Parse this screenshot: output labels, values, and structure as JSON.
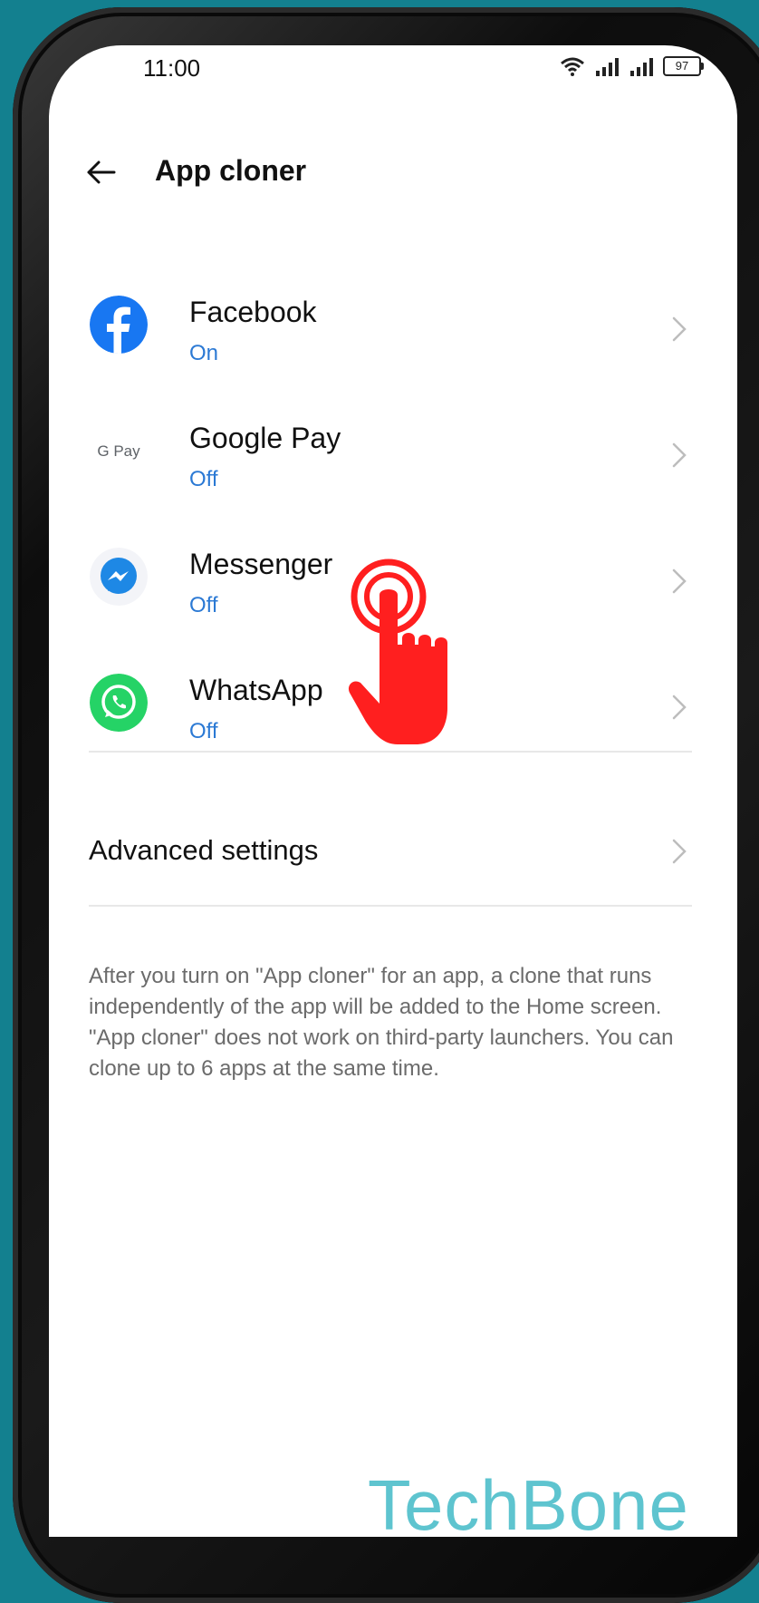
{
  "status_bar": {
    "time": "11:00",
    "battery": "97"
  },
  "header": {
    "title": "App cloner"
  },
  "apps": [
    {
      "name": "Facebook",
      "status": "On",
      "icon": "facebook-icon"
    },
    {
      "name": "Google Pay",
      "status": "Off",
      "icon": "google-pay-icon"
    },
    {
      "name": "Messenger",
      "status": "Off",
      "icon": "messenger-icon"
    },
    {
      "name": "WhatsApp",
      "status": "Off",
      "icon": "whatsapp-icon"
    }
  ],
  "advanced": {
    "label": "Advanced settings"
  },
  "description": "After you turn on \"App cloner\" for an app, a clone that runs independently of the app will be added to the Home screen. \"App cloner\" does not work on third-party launchers. You can clone up to 6 apps at the same time.",
  "watermark": "TechBone",
  "google_pay_icon_text": "G Pay",
  "colors": {
    "background": "#13808f",
    "status_blue": "#2b79d4",
    "facebook_blue": "#1877f2",
    "whatsapp_green": "#25d366",
    "tap_red": "#ff1f1f",
    "watermark": "#5ec4cf"
  }
}
